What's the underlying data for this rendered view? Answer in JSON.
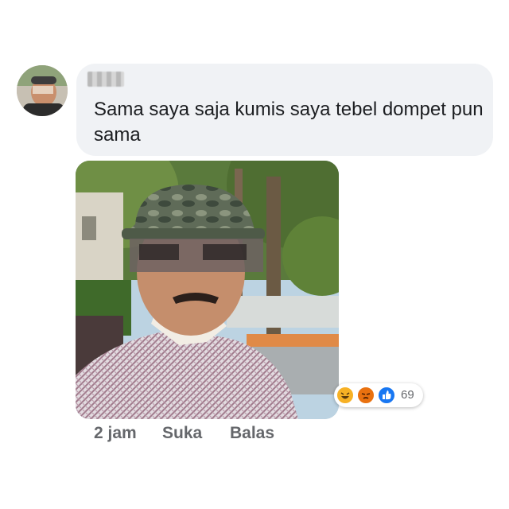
{
  "comment": {
    "author_name": "",
    "text": "Sama saya saja kumis saya tebel dompet pun sama"
  },
  "reactions": {
    "icons": [
      "haha-icon",
      "angry-icon",
      "like-icon"
    ],
    "count": "69"
  },
  "actions": {
    "time": "2 jam",
    "like_label": "Suka",
    "reply_label": "Balas"
  },
  "colors": {
    "bubble": "#f0f2f5",
    "text": "#1c1e21",
    "meta": "#65676b",
    "like_blue": "#1877f2",
    "angry_red": "#e9710f",
    "haha_yellow": "#f7b125"
  }
}
